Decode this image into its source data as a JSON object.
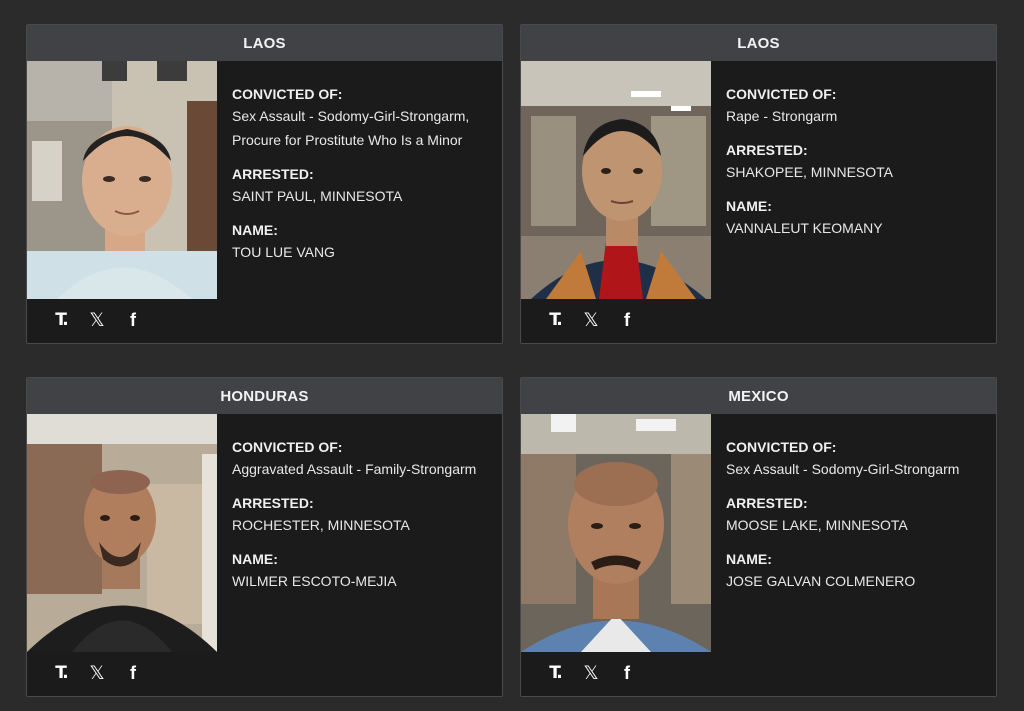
{
  "cards": [
    {
      "country": "LAOS",
      "convicted_label": "CONVICTED OF:",
      "convicted_of": "Sex Assault - Sodomy-Girl-Strongarm, Procure for Prostitute Who Is a Minor",
      "arrested_label": "ARRESTED:",
      "arrested": "SAINT PAUL, MINNESOTA",
      "name_label": "NAME:",
      "name": "TOU LUE VANG"
    },
    {
      "country": "LAOS",
      "convicted_label": "CONVICTED OF:",
      "convicted_of": "Rape - Strongarm",
      "arrested_label": "ARRESTED:",
      "arrested": "SHAKOPEE, MINNESOTA",
      "name_label": "NAME:",
      "name": "VANNALEUT KEOMANY"
    },
    {
      "country": "HONDURAS",
      "convicted_label": "CONVICTED OF:",
      "convicted_of": "Aggravated Assault - Family-Strongarm",
      "arrested_label": "ARRESTED:",
      "arrested": "ROCHESTER, MINNESOTA",
      "name_label": "NAME:",
      "name": "WILMER ESCOTO-MEJIA"
    },
    {
      "country": "MEXICO",
      "convicted_label": "CONVICTED OF:",
      "convicted_of": "Sex Assault - Sodomy-Girl-Strongarm",
      "arrested_label": "ARRESTED:",
      "arrested": "MOOSE LAKE, MINNESOTA",
      "name_label": "NAME:",
      "name": "JOSE GALVAN COLMENERO"
    }
  ],
  "share_icons": {
    "t": "T.",
    "x": "𝕏",
    "f": "f"
  },
  "colors": {
    "background": "#2b2b2b",
    "card": "#1b1b1b",
    "header": "#404246",
    "text": "#f0f0f0"
  }
}
